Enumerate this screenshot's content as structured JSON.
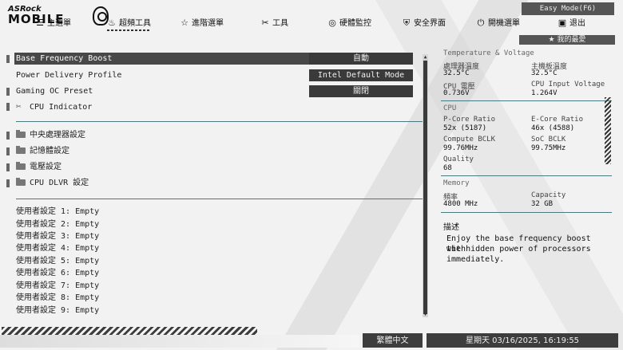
{
  "logo": {
    "brand": "ASRock",
    "series": "MOBILE"
  },
  "nav": [
    {
      "icon": "list-icon",
      "glyph": "☰",
      "label": "主選單"
    },
    {
      "icon": "flame-icon",
      "glyph": "♨",
      "label": "超頻工具"
    },
    {
      "icon": "star-icon",
      "glyph": "☆",
      "label": "進階選單"
    },
    {
      "icon": "tools-icon",
      "glyph": "✂",
      "label": "工具"
    },
    {
      "icon": "monitor-icon",
      "glyph": "◎",
      "label": "硬體監控"
    },
    {
      "icon": "shield-icon",
      "glyph": "⛨",
      "label": "安全界面"
    },
    {
      "icon": "power-icon",
      "glyph": "⏻",
      "label": "開機選單"
    },
    {
      "icon": "exit-icon",
      "glyph": "▣",
      "label": "退出"
    }
  ],
  "easy_mode": "Easy Mode(F6)",
  "favorites": "★ 我的最愛",
  "settings": [
    {
      "label": "Base Frequency Boost",
      "value": "自動"
    },
    {
      "label": "Power Delivery Profile",
      "value": "Intel Default Mode"
    },
    {
      "label": "Gaming OC Preset",
      "value": "關閉"
    },
    {
      "label": "CPU Indicator"
    }
  ],
  "submenus": [
    {
      "label": "中央處理器設定"
    },
    {
      "label": "記憶體設定"
    },
    {
      "label": "電壓設定"
    },
    {
      "label": "CPU DLVR 設定"
    }
  ],
  "user_profiles": [
    "使用者設定 1: Empty",
    "使用者設定 2: Empty",
    "使用者設定 3: Empty",
    "使用者設定 4: Empty",
    "使用者設定 5: Empty",
    "使用者設定 6: Empty",
    "使用者設定 7: Empty",
    "使用者設定 8: Empty",
    "使用者設定 9: Empty"
  ],
  "monitor": {
    "temp_section": "Temperature & Voltage",
    "cpu_temp_label": "處理器溫度",
    "cpu_temp": "32.5°C",
    "mb_temp_label": "主機板溫度",
    "mb_temp": "32.5°C",
    "cpu_voltage_label": "CPU 電壓",
    "cpu_voltage": "0.736V",
    "cpu_input_label": "CPU Input Voltage",
    "cpu_input": "1.264V",
    "cpu_section": "CPU",
    "pcore_label": "P-Core Ratio",
    "pcore": "52x (5187)",
    "ecore_label": "E-Core Ratio",
    "ecore": "46x (4588)",
    "compute_bclk_label": "Compute BCLK",
    "compute_bclk": "99.76MHz",
    "soc_bclk_label": "SoC BCLK",
    "soc_bclk": "99.75MHz",
    "quality_label": "Quality",
    "quality": "68",
    "memory_section": "Memory",
    "freq_label": "頻率",
    "freq": "4800 MHz",
    "capacity_label": "Capacity",
    "capacity": "32 GB"
  },
  "description": {
    "title": "描述",
    "line1": "Enjoy the base frequency boost with",
    "line2": "the hidden power of processors",
    "line3": "immediately."
  },
  "footer": {
    "language": "繁體中文",
    "datetime": "星期天 03/16/2025, 16:19:55"
  }
}
